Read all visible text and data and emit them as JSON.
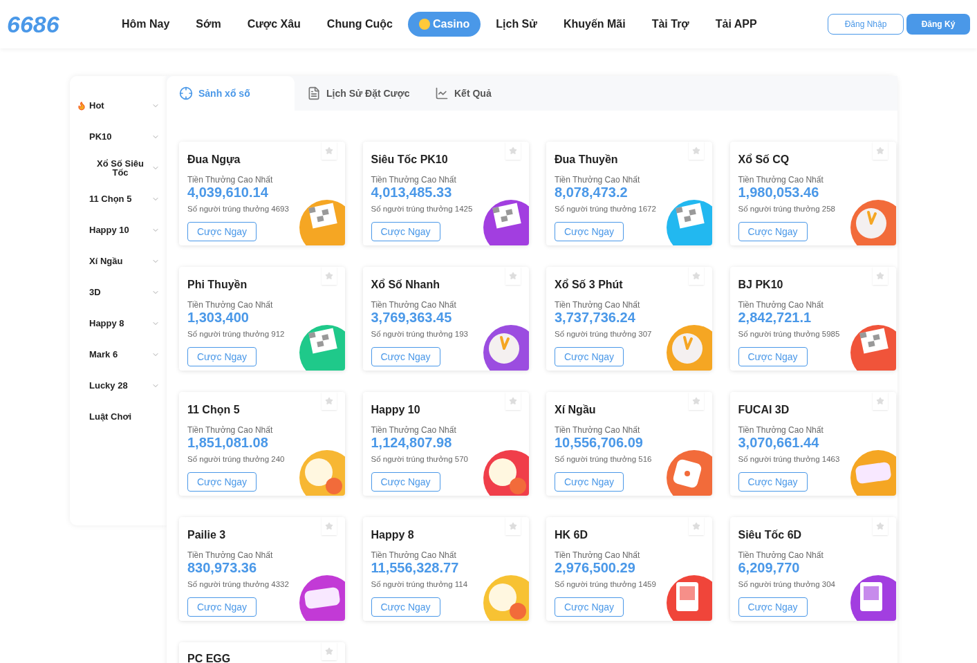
{
  "logo": "6686",
  "nav": [
    {
      "label": "Hôm Nay",
      "selected": false
    },
    {
      "label": "Sớm",
      "selected": false
    },
    {
      "label": "Cược Xâu",
      "selected": false
    },
    {
      "label": "Chung Cuộc",
      "selected": false
    },
    {
      "label": "Casino",
      "selected": true
    },
    {
      "label": "Lịch Sử",
      "selected": false
    },
    {
      "label": "Khuyến Mãi",
      "selected": false
    },
    {
      "label": "Tài Trợ",
      "selected": false
    },
    {
      "label": "Tải APP",
      "selected": false
    }
  ],
  "auth": {
    "login": "Đăng Nhập",
    "register": "Đăng Ký"
  },
  "sidebar": [
    {
      "label": "Hot",
      "kind": "hot",
      "expanded": false
    },
    {
      "label": "PK10",
      "kind": "group",
      "expanded": false
    },
    {
      "label": "Xổ Số Siêu Tốc",
      "kind": "group",
      "expanded": false
    },
    {
      "label": "11 Chọn 5",
      "kind": "group",
      "expanded": false
    },
    {
      "label": "Happy 10",
      "kind": "group",
      "expanded": false
    },
    {
      "label": "Xí Ngầu",
      "kind": "group",
      "expanded": false
    },
    {
      "label": "3D",
      "kind": "group",
      "expanded": false
    },
    {
      "label": "Happy 8",
      "kind": "group",
      "expanded": false
    },
    {
      "label": "Mark 6",
      "kind": "group",
      "expanded": false
    },
    {
      "label": "Lucky 28",
      "kind": "group",
      "expanded": false
    },
    {
      "label": "Luật Chơi",
      "kind": "link"
    }
  ],
  "tabs": [
    {
      "label": "Sảnh xổ số",
      "kind": "lobby",
      "selected": true
    },
    {
      "label": "Lịch Sử Đặt Cược",
      "kind": "history",
      "selected": false
    },
    {
      "label": "Kết Quả",
      "kind": "results",
      "selected": false
    }
  ],
  "games": [
    {
      "name": "Đua Ngựa",
      "prize_label": "Tiền Thưởng Cao Nhất",
      "prize": "4,039,610.14",
      "winners": "Số người trúng thưởng 4693",
      "button": "Cược Ngay",
      "kind": "flag",
      "color": "#f5a623"
    },
    {
      "name": "Siêu Tốc PK10",
      "prize_label": "Tiền Thưởng Cao Nhất",
      "prize": "4,013,485.33",
      "winners": "Số người trúng thưởng 1425",
      "button": "Cược Ngay",
      "kind": "flag",
      "color": "#a23ee0"
    },
    {
      "name": "Đua Thuyền",
      "prize_label": "Tiền Thưởng Cao Nhất",
      "prize": "8,078,473.2",
      "winners": "Số người trúng thưởng 1672",
      "button": "Cược Ngay",
      "kind": "flag",
      "color": "#22b8f0"
    },
    {
      "name": "Xổ Số CQ",
      "prize_label": "Tiền Thưởng Cao Nhất",
      "prize": "1,980,053.46",
      "winners": "Số người trúng thưởng 258",
      "button": "Cược Ngay",
      "kind": "clock",
      "color": "#f26b3a"
    },
    {
      "name": "Phi Thuyền",
      "prize_label": "Tiền Thưởng Cao Nhất",
      "prize": "1,303,400",
      "winners": "Số người trúng thưởng 912",
      "button": "Cược Ngay",
      "kind": "flag",
      "color": "#1fc98a"
    },
    {
      "name": "Xổ Số Nhanh",
      "prize_label": "Tiền Thưởng Cao Nhất",
      "prize": "3,769,363.45",
      "winners": "Số người trúng thưởng 193",
      "button": "Cược Ngay",
      "kind": "clock",
      "color": "#9b4de0"
    },
    {
      "name": "Xổ Số 3 Phút",
      "prize_label": "Tiền Thưởng Cao Nhất",
      "prize": "3,737,736.24",
      "winners": "Số người trúng thưởng 307",
      "button": "Cược Ngay",
      "kind": "clock",
      "color": "#f5a623"
    },
    {
      "name": "BJ PK10",
      "prize_label": "Tiền Thưởng Cao Nhất",
      "prize": "2,842,721.1",
      "winners": "Số người trúng thưởng 5985",
      "button": "Cược Ngay",
      "kind": "flag",
      "color": "#f0543a"
    },
    {
      "name": "11 Chọn 5",
      "prize_label": "Tiền Thưởng Cao Nhất",
      "prize": "1,851,081.08",
      "winners": "Số người trúng thưởng 240",
      "button": "Cược Ngay",
      "kind": "ball",
      "color": "#f7b733"
    },
    {
      "name": "Happy 10",
      "prize_label": "Tiền Thưởng Cao Nhất",
      "prize": "1,124,807.98",
      "winners": "Số người trúng thưởng 570",
      "button": "Cược Ngay",
      "kind": "ball",
      "color": "#f03e4a"
    },
    {
      "name": "Xí Ngầu",
      "prize_label": "Tiền Thưởng Cao Nhất",
      "prize": "10,556,706.09",
      "winners": "Số người trúng thưởng 516",
      "button": "Cược Ngay",
      "kind": "dice",
      "color": "#f26b3a"
    },
    {
      "name": "FUCAI 3D",
      "prize_label": "Tiền Thưởng Cao Nhất",
      "prize": "3,070,661.44",
      "winners": "Số người trúng thưởng 1463",
      "button": "Cược Ngay",
      "kind": "threed",
      "color": "#f5a623"
    },
    {
      "name": "Pailie 3",
      "prize_label": "Tiền Thưởng Cao Nhất",
      "prize": "830,973.36",
      "winners": "Số người trúng thưởng 4332",
      "button": "Cược Ngay",
      "kind": "threed",
      "color": "#c23ad6"
    },
    {
      "name": "Happy 8",
      "prize_label": "Tiền Thưởng Cao Nhất",
      "prize": "11,556,328.77",
      "winners": "Số người trúng thưởng 114",
      "button": "Cược Ngay",
      "kind": "ball",
      "color": "#f7c233"
    },
    {
      "name": "HK 6D",
      "prize_label": "Tiền Thưởng Cao Nhất",
      "prize": "2,976,500.29",
      "winners": "Số người trúng thưởng 1459",
      "button": "Cược Ngay",
      "kind": "machine",
      "color": "#f0453a"
    },
    {
      "name": "Siêu Tốc 6D",
      "prize_label": "Tiền Thưởng Cao Nhất",
      "prize": "6,209,770",
      "winners": "Số người trúng thưởng 304",
      "button": "Cược Ngay",
      "kind": "machine",
      "color": "#a23ee0"
    },
    {
      "name": "PC EGG",
      "kind": "partial"
    }
  ]
}
